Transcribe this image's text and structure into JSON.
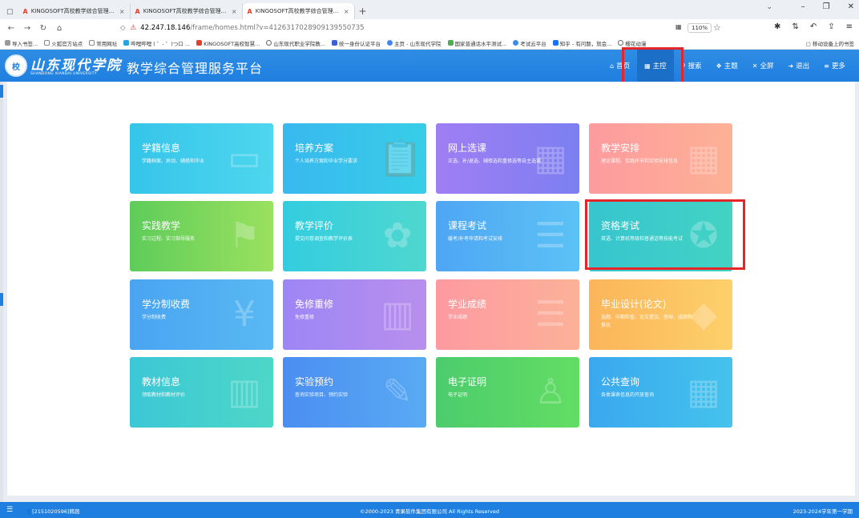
{
  "browser": {
    "tabs": [
      {
        "title": "KINGOSOFT高校教学综合管理..."
      },
      {
        "title": "KINGOSOFT高校教学综合管理..."
      },
      {
        "title": "KINGOSOFT高校教学综合管理..."
      }
    ],
    "url_host": "42.247.18.146",
    "url_path": "/frame/homes.html?v=4126317028909139550735",
    "zoom": "110%",
    "bookmarks": [
      "导入书签...",
      "火狐官方站点",
      "常用网址",
      "哔哩哔哩 ( ゜- ゜)つロ ...",
      "KINGOSOFT高校智慧...",
      "山东现代职业学院教...",
      "统一身份认证平台",
      "主页 - 山东现代学院",
      "国家普通话水平测试...",
      "考试云平台",
      "知乎 - 有问题，就会...",
      "樱花动漫"
    ],
    "mobile_bookmarks": "移动设备上的书签"
  },
  "header": {
    "logo_cn": "山东现代学院",
    "logo_en": "SHANDONG XIANDAI UNIVERSITY",
    "platform_title": "教学综合管理服务平台",
    "nav": [
      {
        "label": "首页",
        "icon": "home-icon"
      },
      {
        "label": "主控",
        "icon": "windows-icon"
      },
      {
        "label": "搜索",
        "icon": "search-icon"
      },
      {
        "label": "主题",
        "icon": "palette-icon"
      },
      {
        "label": "全屏",
        "icon": "fullscreen-icon"
      },
      {
        "label": "退出",
        "icon": "logout-icon"
      },
      {
        "label": "更多",
        "icon": "menu-icon"
      }
    ]
  },
  "tiles": [
    {
      "title": "学籍信息",
      "desc": "学籍档案、异动、辅修和毕业",
      "color1": "#35c5ea",
      "color2": "#4fd6ee",
      "icon": "id-card-icon"
    },
    {
      "title": "培养方案",
      "desc": "个人培养方案和毕业学分要求",
      "color1": "#39b9ee",
      "color2": "#37cde8",
      "icon": "clipboard-icon"
    },
    {
      "title": "网上选课",
      "desc": "正选、补/退选、辅修选和重修选等自主选课",
      "color1": "#a07ef4",
      "color2": "#7c7ff1",
      "icon": "touch-calendar-icon"
    },
    {
      "title": "教学安排",
      "desc": "理论课程、实践环节和实验安排信息",
      "color1": "#fd9b9f",
      "color2": "#fdb195",
      "icon": "calendar-icon"
    },
    {
      "title": "实践教学",
      "desc": "实习过程、实习指导服务",
      "color1": "#5ecc5a",
      "color2": "#9be15f",
      "icon": "flag-icon"
    },
    {
      "title": "教学评价",
      "desc": "提交问卷调查和教学评价表",
      "color1": "#33cde0",
      "color2": "#4fd7cf",
      "icon": "flower-icon"
    },
    {
      "title": "课程考试",
      "desc": "缓考/补考申请和考试安排",
      "color1": "#4fa6f3",
      "color2": "#5cc2f6",
      "icon": "scroll-icon"
    },
    {
      "title": "资格考试",
      "desc": "英语、计算机等级和普通话等技能考试",
      "color1": "#37c5cf",
      "color2": "#43d3c3",
      "icon": "certificate-icon"
    },
    {
      "title": "学分制收费",
      "desc": "学分制收费",
      "color1": "#4aa4f1",
      "color2": "#58b9f3",
      "icon": "yuan-icon"
    },
    {
      "title": "免修重修",
      "desc": "免修重修",
      "color1": "#9c86f5",
      "color2": "#b98fed",
      "icon": "books-icon"
    },
    {
      "title": "学业成绩",
      "desc": "学业成绩",
      "color1": "#fd9aa1",
      "color2": "#fcb198",
      "icon": "document-icon"
    },
    {
      "title": "毕业设计(论文)",
      "desc": "选题、中期检查、论文提交、答辩、成绩和推优",
      "color1": "#fbb55a",
      "color2": "#fdd06b",
      "icon": "graduation-cap-icon"
    },
    {
      "title": "教材信息",
      "desc": "领取教材和教材评价",
      "color1": "#3cc7d6",
      "color2": "#4dd7c8",
      "icon": "bookshelf-icon"
    },
    {
      "title": "实验预约",
      "desc": "查询实验项目、预约实验",
      "color1": "#4b8ef2",
      "color2": "#59aaf3",
      "icon": "edit-document-icon"
    },
    {
      "title": "电子证明",
      "desc": "电子证明",
      "color1": "#4ccc6d",
      "color2": "#63dd63",
      "icon": "presenter-icon"
    },
    {
      "title": "公共查询",
      "desc": "各类课表信息的开放查询",
      "color1": "#3aa8ee",
      "color2": "#44c3ec",
      "icon": "grid-calendar-icon"
    }
  ],
  "footer": {
    "user": "[2151020596]韩茵",
    "copyright": "©2000-2023 青果软件集团有限公司 All Rights Reserved",
    "term": "2023-2024学年第一学期"
  },
  "colors": {
    "header_blue": "#1f7fe0",
    "active_nav": "#1b6fc7",
    "highlight_red": "#e4262a"
  }
}
